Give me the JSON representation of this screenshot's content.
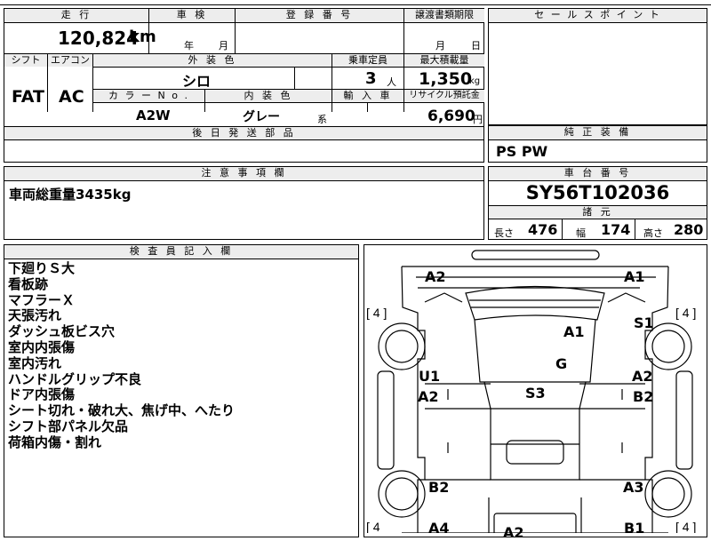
{
  "top_table": {
    "headers": {
      "mileage": "走 行",
      "inspection": "車 検",
      "registration": "登 録 番 号",
      "transfer_docs": "譲渡書類期限",
      "shift": "シフト",
      "aircon": "エアコン",
      "exterior_color": "外 装 色",
      "capacity": "乗車定員",
      "max_load": "最大積載量",
      "color_no": "カ ラ ー N o .",
      "interior_color": "内 装 色",
      "import": "輸 入 車",
      "recycle": "リサイクル預託金",
      "later_parts": "後 日 発 送 部 品"
    },
    "mileage_value": "120,824",
    "mileage_unit": "km",
    "inspection_year_unit": "年",
    "inspection_month_unit": "月",
    "transfer_month_unit": "月",
    "transfer_day_unit": "日",
    "shift_value": "FAT",
    "aircon_value": "AC",
    "exterior_color_value": "シロ",
    "capacity_value": "3",
    "capacity_unit": "人",
    "max_load_value": "1,350",
    "max_load_unit": "kg",
    "color_no_value": "A2W",
    "interior_color_value": "グレー",
    "interior_color_suffix": "系",
    "recycle_value": "6,690",
    "recycle_unit": "円"
  },
  "sales_point": {
    "header": "セ ー ル ス ポ イ ン ト"
  },
  "genuine_equipment": {
    "header": "純 正 装 備",
    "value": "PS PW"
  },
  "notes": {
    "header": "注 意 事 項 欄",
    "value": "車両総重量3435kg"
  },
  "chassis": {
    "header": "車 台 番 号",
    "value": "SY56T102036",
    "dimensions_header": "諸 元",
    "length_label": "長さ",
    "length_value": "476",
    "width_label": "幅",
    "width_value": "174",
    "height_label": "高さ",
    "height_value": "280"
  },
  "inspector": {
    "header": "検 査 員 記 入 欄",
    "lines": [
      "下廻りＳ大",
      "看板跡",
      "マフラーＸ",
      "天張汚れ",
      "ダッシュ板ビス穴",
      "室内内張傷",
      "室内汚れ",
      "ハンドルグリップ不良",
      "ドア内張傷",
      "シート切れ・破れ大、焦げ中、へたり",
      "シフト部パネル欠品",
      "荷箱内傷・割れ"
    ]
  },
  "diagram": {
    "tire_left_top": "[ 4 ]",
    "tire_right_top": "[ 4 ]",
    "tire_left_bottom": "[ 4",
    "tire_right_bottom": "[ 4 ]",
    "codes": {
      "a2_top_left": "A2",
      "a1_top_right": "A1",
      "s1": "S1",
      "a1_center": "A1",
      "g": "G",
      "u1": "U1",
      "a2_left": "A2",
      "s3": "S3",
      "a2_right": "A2",
      "b2_right": "B2",
      "b2_left": "B2",
      "a3": "A3",
      "a4": "A4",
      "a2_bottom": "A2",
      "b1": "B1"
    }
  }
}
